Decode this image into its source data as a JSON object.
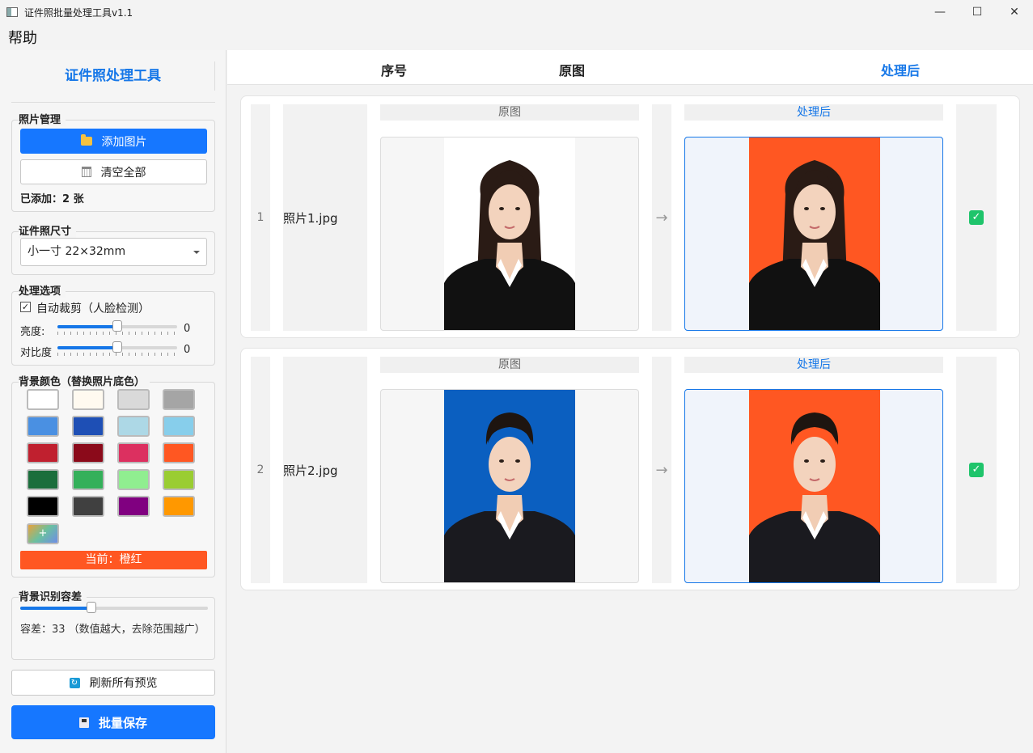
{
  "window": {
    "title": "证件照批量处理工具v1.1",
    "minimize": "—",
    "maximize": "☐",
    "close": "✕"
  },
  "menu": {
    "help": "帮助"
  },
  "sidebar": {
    "title": "证件照处理工具",
    "photo_manage": {
      "label": "照片管理",
      "add_button": "添加图片",
      "clear_button": "清空全部",
      "count_text": "已添加：2 张"
    },
    "size": {
      "label": "证件照尺寸",
      "selected": "小一寸  22×32mm"
    },
    "options": {
      "label": "处理选项",
      "auto_crop_checked": true,
      "auto_crop_label": "自动裁剪（人脸检测）",
      "brightness_label": "亮度:",
      "brightness_value": "0",
      "brightness_level": 0.5,
      "contrast_label": "对比度",
      "contrast_value": "0",
      "contrast_level": 0.5
    },
    "background": {
      "label": "背景颜色（替换照片底色）",
      "swatches": [
        "#ffffff",
        "#fffaf0",
        "#d9d9d9",
        "#a5a5a5",
        "#4a90e2",
        "#1e4fb5",
        "#add8e6",
        "#87ceeb",
        "#c0202f",
        "#8b0a1a",
        "#dc3060",
        "#ff5722",
        "#1b6e3c",
        "#34b05a",
        "#90ee90",
        "#9acd32",
        "#000000",
        "#404040",
        "#800080",
        "#ff9800"
      ],
      "add_label": "+",
      "current_text": "当前：橙红",
      "current_color": "#ff5722"
    },
    "tolerance": {
      "label": "背景识别容差",
      "level": 0.38,
      "text": "容差：33  （数值越大，去除范围越广）"
    },
    "refresh_button": "刷新所有预览",
    "save_button": "批量保存"
  },
  "table": {
    "headers": {
      "index": "序号",
      "original": "原图",
      "processed": "处理后"
    },
    "rows": [
      {
        "index": "1",
        "name": "照片1.jpg",
        "original_label": "原图",
        "processed_label": "处理后",
        "arrow": "→",
        "orig_bg": "#ffffff",
        "proc_bg": "#ff5722",
        "shirt": "#111111",
        "hair": "#2a1b15",
        "long_hair": true
      },
      {
        "index": "2",
        "name": "照片2.jpg",
        "original_label": "原图",
        "processed_label": "处理后",
        "arrow": "→",
        "orig_bg": "#0b5fc0",
        "proc_bg": "#ff5722",
        "shirt": "#1a1a1f",
        "hair": "#1e1510",
        "long_hair": false
      }
    ]
  }
}
